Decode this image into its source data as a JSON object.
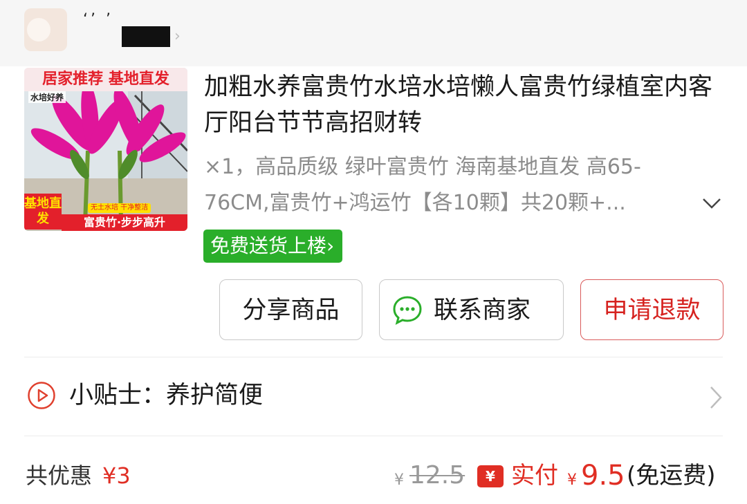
{
  "shop": {
    "name_marks": "‘’ ’",
    "chevron": "›"
  },
  "product": {
    "image_tags": {
      "top": "居家推荐 基地直发",
      "sub": "水培好养",
      "left": "基地直发",
      "small": "无土水培 干净整洁",
      "bottom": "富贵竹·步步高升"
    },
    "title": "加粗水养富贵竹水培水培懒人富贵竹绿植室内客厅阳台节节高招财转",
    "spec": "×1，高品质级 绿叶富贵竹 海南基地直发 高65-76CM,富贵竹+鸿运竹【各10颗】共20颗+..."
  },
  "service_tag": {
    "label": "免费送货上楼",
    "arrow": "›",
    "color": "#2aae2a"
  },
  "actions": {
    "share": "分享商品",
    "contact": "联系商家",
    "refund": "申请退款"
  },
  "tip": {
    "text": "小贴士：养护简便"
  },
  "summary": {
    "discount_label": "共优惠",
    "discount_value": "¥3",
    "currency": "¥",
    "original_price": "12.5",
    "pay_badge": "¥",
    "pay_label": "实付",
    "pay_value": "9.5",
    "shipping_note": "(免运费)",
    "accent_color": "#e02e24"
  }
}
